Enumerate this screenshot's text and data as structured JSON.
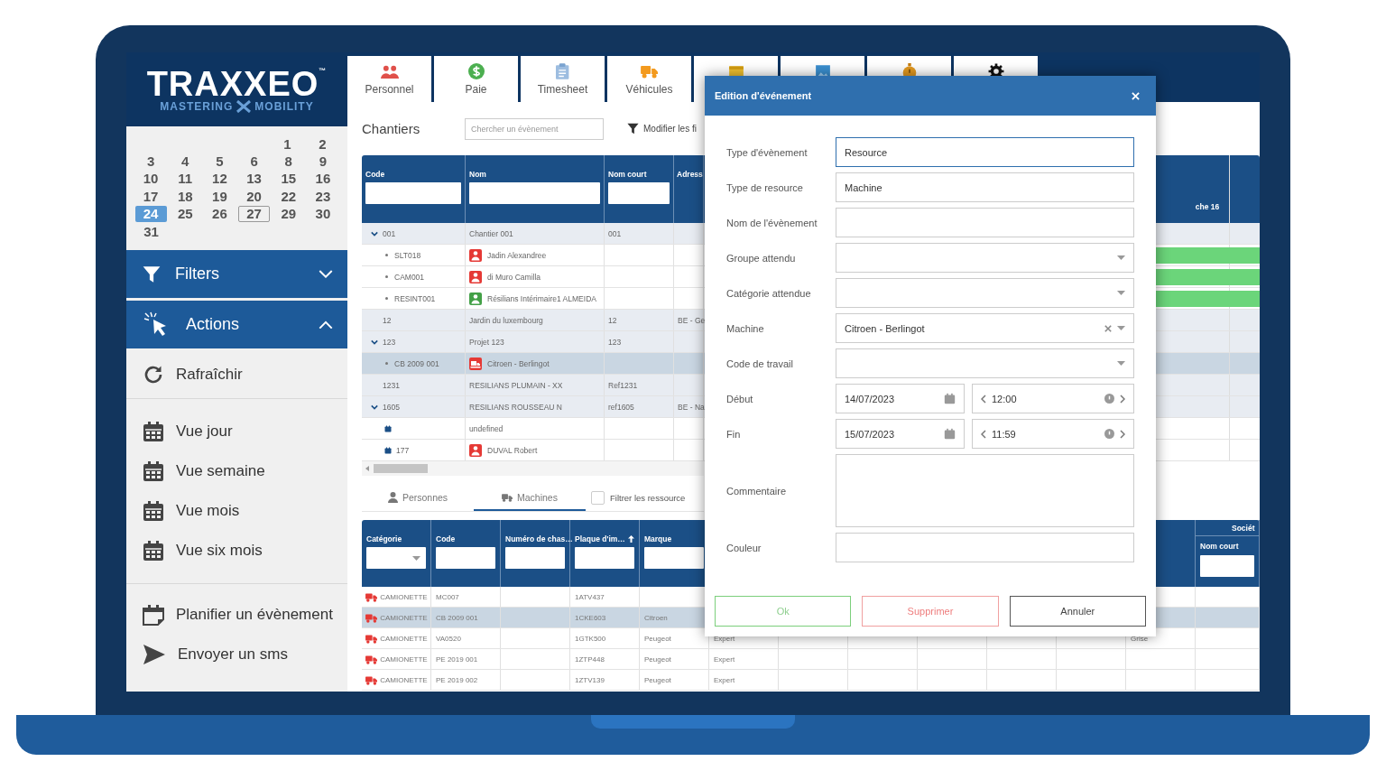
{
  "sidebar": {
    "logo": {
      "wordmark": "TRAXXEO",
      "trademark": "™",
      "tagline": [
        "MASTERING",
        "MOBILITY"
      ]
    },
    "calendar": {
      "weeks": [
        [
          {
            "day": "1",
            "selected": false,
            "today": false
          },
          {
            "day": "2",
            "selected": false,
            "today": false
          }
        ],
        [
          {
            "day": "3",
            "selected": false,
            "today": false
          },
          {
            "day": "4",
            "selected": false,
            "today": false
          },
          {
            "day": "5",
            "selected": false,
            "today": false
          },
          {
            "day": "6",
            "selected": false,
            "today": false
          },
          {
            "day": "8",
            "selected": false,
            "today": false
          },
          {
            "day": "9",
            "selected": false,
            "today": false
          }
        ],
        [
          {
            "day": "10",
            "selected": false,
            "today": false
          },
          {
            "day": "11",
            "selected": false,
            "today": false
          },
          {
            "day": "12",
            "selected": false,
            "today": false
          },
          {
            "day": "13",
            "selected": false,
            "today": false
          },
          {
            "day": "15",
            "selected": false,
            "today": false
          },
          {
            "day": "16",
            "selected": false,
            "today": false
          }
        ],
        [
          {
            "day": "17",
            "selected": false,
            "today": false
          },
          {
            "day": "18",
            "selected": false,
            "today": false
          },
          {
            "day": "19",
            "selected": false,
            "today": false
          },
          {
            "day": "20",
            "selected": false,
            "today": false
          },
          {
            "day": "22",
            "selected": false,
            "today": false
          },
          {
            "day": "23",
            "selected": false,
            "today": false
          }
        ],
        [
          {
            "day": "24",
            "selected": true,
            "today": false
          },
          {
            "day": "25",
            "selected": false,
            "today": false
          },
          {
            "day": "26",
            "selected": false,
            "today": false
          },
          {
            "day": "27",
            "selected": false,
            "today": true
          },
          {
            "day": "29",
            "selected": false,
            "today": false
          },
          {
            "day": "30",
            "selected": false,
            "today": false
          }
        ],
        [
          {
            "day": "31",
            "selected": false,
            "today": false
          }
        ]
      ]
    },
    "sections": [
      {
        "kind": "filters",
        "label": "Filters",
        "expanded": false
      },
      {
        "kind": "actions",
        "label": "Actions",
        "expanded": true,
        "groups": [
          [
            {
              "kind": "refresh",
              "label": "Rafraîchir"
            }
          ],
          [
            {
              "kind": "view",
              "label": "Vue jour"
            },
            {
              "kind": "view",
              "label": "Vue semaine"
            },
            {
              "kind": "view",
              "label": "Vue mois"
            },
            {
              "kind": "view",
              "label": "Vue six mois"
            }
          ],
          [
            {
              "kind": "plan",
              "label": "Planifier un évènement"
            },
            {
              "kind": "send",
              "label": "Envoyer un sms"
            }
          ]
        ]
      }
    ]
  },
  "module_tabs": [
    {
      "kind": "people",
      "label": "Personnel"
    },
    {
      "kind": "pay",
      "label": "Paie"
    },
    {
      "kind": "timesheet",
      "label": "Timesheet"
    },
    {
      "kind": "vehicles",
      "label": "Véhicules"
    },
    {
      "kind": "planning"
    },
    {
      "kind": "gallery"
    },
    {
      "kind": "timer"
    },
    {
      "kind": "settings"
    }
  ],
  "chantiers": {
    "title": "Chantiers",
    "search": {
      "placeholder": "Chercher un évènement"
    },
    "filter_button": "Modifier les fi",
    "columns": [
      "Code",
      "Nom",
      "Nom court",
      "Adress"
    ],
    "schedule_columns": [
      "che 16"
    ],
    "rows": [
      {
        "code": "001",
        "nom": "Chantier 001",
        "nom_court": "001",
        "expanded": true,
        "selected": false,
        "scheduled": false,
        "children": [
          {
            "kind": "resource",
            "code": "SLT018",
            "nom": "Jadin Alexandree",
            "badge": {
              "kind": "person",
              "color": "#e53935"
            },
            "selected": false,
            "scheduled": true
          },
          {
            "kind": "resource",
            "code": "CAM001",
            "nom": "di Muro Camilla",
            "badge": {
              "kind": "person",
              "color": "#e53935"
            },
            "selected": false,
            "scheduled": true
          },
          {
            "kind": "resource",
            "code": "RESINT001",
            "nom": "Résilians Intérimaire1 ALMEIDA",
            "badge": {
              "kind": "person",
              "color": "#43a047"
            },
            "selected": false,
            "scheduled": true
          }
        ]
      },
      {
        "code": "12",
        "nom": "Jardin du luxembourg",
        "nom_court": "12",
        "adresse": "BE - Ge",
        "selected": false,
        "scheduled": false
      },
      {
        "code": "123",
        "nom": "Projet 123",
        "nom_court": "123",
        "expanded": true,
        "selected": false,
        "scheduled": false,
        "children": [
          {
            "kind": "resource",
            "code": "CB 2009 001",
            "nom": "Citroen - Berlingot",
            "badge": {
              "kind": "vehicle",
              "color": "#e53935"
            },
            "selected": true,
            "scheduled": false
          }
        ]
      },
      {
        "code": "1231",
        "nom": "RESILIANS PLUMAIN - XX",
        "nom_court": "Ref1231",
        "selected": false,
        "scheduled": false
      },
      {
        "code": "1605",
        "nom": "RESILIANS ROUSSEAU N",
        "nom_court": "ref1605",
        "adresse": "BE - Na",
        "expanded": true,
        "selected": false,
        "scheduled": false,
        "children": [
          {
            "kind": "event",
            "nom": "undefined",
            "selected": false,
            "scheduled": false
          },
          {
            "kind": "event",
            "code": "177",
            "nom": "DUVAL Robert",
            "badge": {
              "kind": "person",
              "color": "#e53935"
            },
            "selected": false,
            "scheduled": false
          }
        ]
      }
    ]
  },
  "resources": {
    "tabs": [
      {
        "kind": "people",
        "label": "Personnes",
        "selected": false
      },
      {
        "kind": "machines",
        "label": "Machines",
        "selected": true
      }
    ],
    "filter_checkbox": {
      "label": "Filtrer les ressource",
      "checked": false
    },
    "columns": [
      {
        "label": "Catégorie",
        "kind": "select",
        "sorted": false
      },
      {
        "label": "Code",
        "kind": "text",
        "sorted": false
      },
      {
        "label": "Numéro de chas…",
        "kind": "text",
        "sorted": false
      },
      {
        "label": "Plaque d'im…",
        "kind": "text",
        "sorted": true
      },
      {
        "label": "Marque",
        "kind": "text",
        "sorted": false
      }
    ],
    "group_column": {
      "group": "Sociét",
      "label": "Nom court"
    },
    "rows": [
      {
        "category": "CAMIONETTE",
        "code": "MC007",
        "plate": "1ATV437",
        "selected": false
      },
      {
        "category": "CAMIONETTE",
        "code": "CB 2009 001",
        "plate": "1CKE603",
        "brand": "Citroen",
        "selected": true
      },
      {
        "category": "CAMIONETTE",
        "code": "VA0520",
        "plate": "1GTK500",
        "brand": "Peugeot",
        "column_6": "Expert",
        "column_12": "Grise",
        "selected": false
      },
      {
        "category": "CAMIONETTE",
        "code": "PE 2019 001",
        "plate": "1ZTP448",
        "brand": "Peugeot",
        "column_6": "Expert",
        "selected": false
      },
      {
        "category": "CAMIONETTE",
        "code": "PE 2019 002",
        "plate": "1ZTV139",
        "brand": "Peugeot",
        "column_6": "Expert",
        "selected": false
      }
    ]
  },
  "event_dialog": {
    "title": "Edition d'événement",
    "fields": [
      {
        "kind": "text",
        "label": "Type d'évènement",
        "value": "Resource",
        "focused": true
      },
      {
        "kind": "text",
        "label": "Type de resource",
        "value": "Machine",
        "focused": false
      },
      {
        "kind": "text",
        "label": "Nom de l'évènement",
        "focused": false
      },
      {
        "kind": "select",
        "label": "Groupe attendu"
      },
      {
        "kind": "select",
        "label": "Catégorie attendue"
      },
      {
        "kind": "select",
        "label": "Machine",
        "value": "Citroen - Berlingot"
      },
      {
        "kind": "select",
        "label": "Code de travail"
      },
      {
        "kind": "datetime",
        "label": "Début",
        "date": "14/07/2023",
        "time": "12:00"
      },
      {
        "kind": "datetime",
        "label": "Fin",
        "date": "15/07/2023",
        "time": "11:59"
      },
      {
        "kind": "textarea",
        "label": "Commentaire"
      },
      {
        "kind": "text",
        "label": "Couleur",
        "focused": false
      }
    ],
    "buttons": [
      {
        "kind": "confirm",
        "label": "Ok"
      },
      {
        "kind": "delete",
        "label": "Supprimer"
      },
      {
        "kind": "cancel",
        "label": "Annuler"
      }
    ]
  }
}
